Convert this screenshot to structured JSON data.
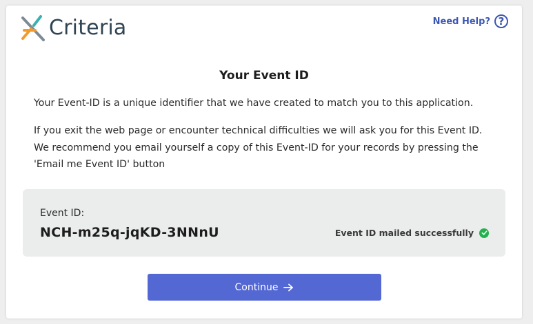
{
  "header": {
    "logo_text": "Criteria",
    "help_label": "Need Help?",
    "help_icon": "?"
  },
  "main": {
    "title": "Your Event ID",
    "paragraph1": "Your Event-ID is a unique identifier that we have created to match you to this application.",
    "paragraph2": "If you exit the web page or encounter technical difficulties we will ask you for this Event ID. We recommend you email yourself a copy of this Event-ID for your records by pressing the 'Email me Event ID' button"
  },
  "event": {
    "label": "Event ID:",
    "value": "NCH-m25q-jqKD-3NNnU",
    "mail_status": "Event ID mailed successfully"
  },
  "actions": {
    "continue_label": "Continue"
  },
  "colors": {
    "accent": "#5468d4",
    "help": "#3b57b3",
    "success": "#22b14c",
    "logo_orange": "#f39a2c",
    "logo_teal": "#3ab0b0",
    "logo_gray": "#7d8a93"
  }
}
